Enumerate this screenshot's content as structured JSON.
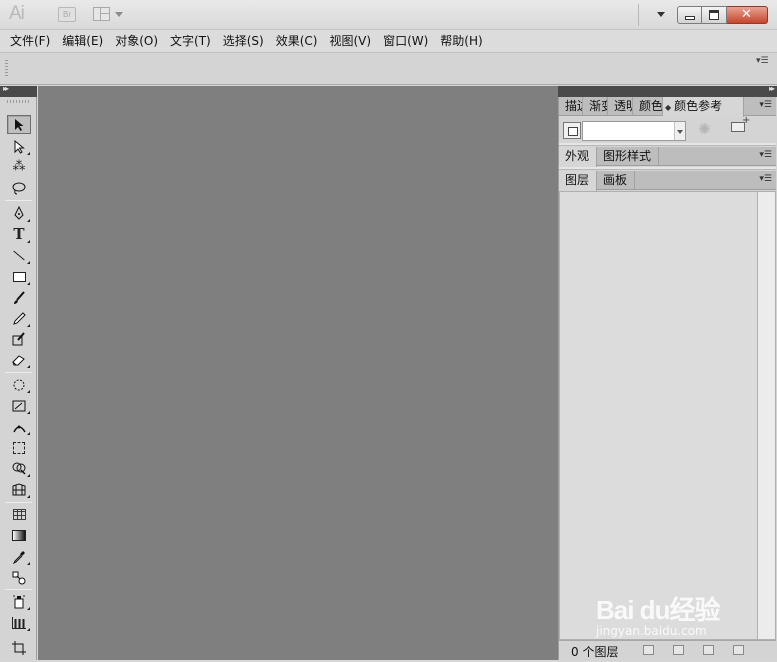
{
  "titlebar": {
    "logo": "Ai",
    "bridge": "Br",
    "close_glyph": "✕"
  },
  "menu": [
    {
      "label": "文件(F)"
    },
    {
      "label": "编辑(E)"
    },
    {
      "label": "对象(O)"
    },
    {
      "label": "文字(T)"
    },
    {
      "label": "选择(S)"
    },
    {
      "label": "效果(C)"
    },
    {
      "label": "视图(V)"
    },
    {
      "label": "窗口(W)"
    },
    {
      "label": "帮助(H)"
    }
  ],
  "tools": {
    "selection": "selection-tool-icon",
    "type_glyph": "T"
  },
  "dock": {
    "color_tabs": [
      "描边",
      "渐变",
      "透明",
      "颜色",
      "颜色参考"
    ],
    "appearance_tabs": [
      "外观",
      "图形样式"
    ],
    "layers_tabs": [
      "图层",
      "画板"
    ],
    "layers_count": "0 个图层"
  },
  "watermark": {
    "text": "Bai du经验",
    "url": "jingyan.baidu.com"
  },
  "colors": {
    "canvas": "#7f7f7f",
    "panel": "#d4d4d4",
    "close": "#c6452d"
  }
}
